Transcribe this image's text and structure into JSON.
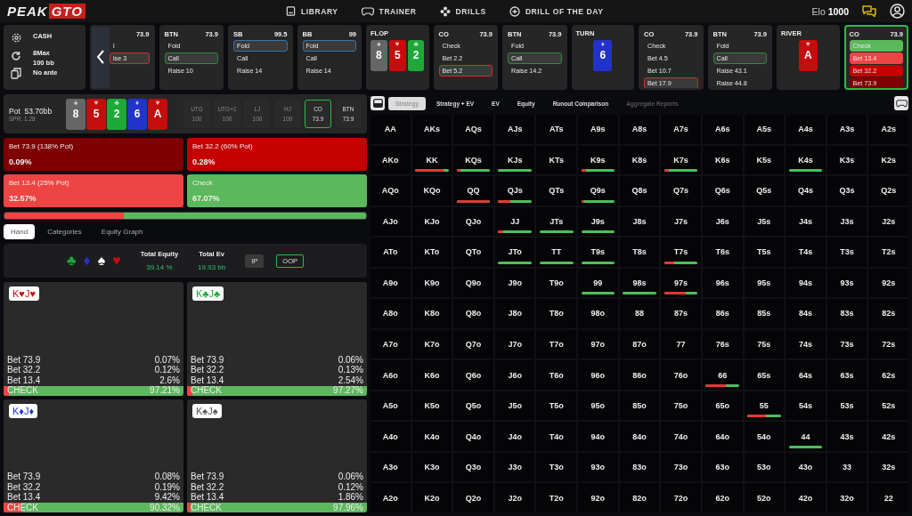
{
  "nav": {
    "logo": {
      "part_1": "PEAK",
      "part_2": "GTO"
    },
    "links": [
      "LIBRARY",
      "TRAINER",
      "DRILLS",
      "DRILL OF THE DAY"
    ],
    "elo": {
      "label": "Elo",
      "value": "1000"
    }
  },
  "settings_card": {
    "lines": [
      "CASH",
      "8Max",
      "100 bb",
      "No ante"
    ]
  },
  "action_strip": [
    {
      "kind": "action",
      "active": false,
      "covered": true,
      "stack": "73.9",
      "options": [
        {
          "label": "l",
          "selected": false
        },
        {
          "label": "ise 3",
          "selected": true,
          "color": "#d32f2f"
        }
      ]
    },
    {
      "kind": "action",
      "active": false,
      "covered": false,
      "position": "BTN",
      "stack": "73.9",
      "options": [
        {
          "label": "Fold",
          "selected": false
        },
        {
          "label": "Call",
          "selected": true,
          "color": "#2e8b3a"
        },
        {
          "label": "Raise 10",
          "selected": false
        }
      ]
    },
    {
      "kind": "action",
      "active": false,
      "covered": false,
      "position": "SB",
      "stack": "99.5",
      "options": [
        {
          "label": "Fold",
          "selected": true,
          "color": "#3d6fb0"
        },
        {
          "label": "Call",
          "selected": false
        },
        {
          "label": "Raise 14",
          "selected": false
        }
      ]
    },
    {
      "kind": "action",
      "active": false,
      "covered": false,
      "position": "BB",
      "stack": "99",
      "options": [
        {
          "label": "Fold",
          "selected": true,
          "color": "#3d6fb0"
        },
        {
          "label": "Call",
          "selected": false
        },
        {
          "label": "Raise 14",
          "selected": false
        }
      ]
    },
    {
      "kind": "street",
      "street": "FLOP",
      "cards": [
        {
          "rank": "8",
          "suit": "♠",
          "color": "#666666"
        },
        {
          "rank": "5",
          "suit": "♥",
          "color": "#c40d0d"
        },
        {
          "rank": "2",
          "suit": "♣",
          "color": "#1ea83a"
        }
      ]
    },
    {
      "kind": "action",
      "active": false,
      "covered": false,
      "position": "CO",
      "stack": "73.9",
      "options": [
        {
          "label": "Check",
          "selected": false
        },
        {
          "label": "Bet 2.2",
          "selected": false
        },
        {
          "label": "Bet 5.2",
          "selected": true,
          "color": "#d32f2f"
        }
      ]
    },
    {
      "kind": "action",
      "active": false,
      "covered": false,
      "position": "BTN",
      "stack": "73.9",
      "options": [
        {
          "label": "Fold",
          "selected": false
        },
        {
          "label": "Call",
          "selected": true,
          "color": "#2e8b3a"
        },
        {
          "label": "Raise 14.2",
          "selected": false
        }
      ]
    },
    {
      "kind": "street",
      "street": "TURN",
      "cards": [
        {
          "rank": "6",
          "suit": "♦",
          "color": "#2233cc"
        }
      ]
    },
    {
      "kind": "action",
      "active": false,
      "covered": false,
      "position": "CO",
      "stack": "73.9",
      "options": [
        {
          "label": "Check",
          "selected": false
        },
        {
          "label": "Bet 4.5",
          "selected": false
        },
        {
          "label": "Bet 10.7",
          "selected": false
        },
        {
          "label": "Bet 17.9",
          "selected": true,
          "color": "#d32f2f"
        }
      ]
    },
    {
      "kind": "action",
      "active": false,
      "covered": false,
      "position": "BTN",
      "stack": "73.9",
      "options": [
        {
          "label": "Fold",
          "selected": false
        },
        {
          "label": "Call",
          "selected": true,
          "color": "#2e8b3a"
        },
        {
          "label": "Raise 43.1",
          "selected": false
        },
        {
          "label": "Raise 44.8",
          "selected": false
        }
      ]
    },
    {
      "kind": "street",
      "street": "RIVER",
      "cards": [
        {
          "rank": "A",
          "suit": "♥",
          "color": "#c40d0d"
        }
      ]
    },
    {
      "kind": "action",
      "active": true,
      "covered": false,
      "position": "CO",
      "stack": "73.9",
      "options": [
        {
          "label": "Check",
          "selected": false,
          "color": "#5cb85c"
        },
        {
          "label": "Bet 13.4",
          "selected": false,
          "color": "#ef4444"
        },
        {
          "label": "Bet 32.2",
          "selected": false,
          "color": "#c40000"
        },
        {
          "label": "Bet 73.9",
          "selected": false,
          "color": "#7e0000"
        }
      ]
    }
  ],
  "board": {
    "pot_label": "Pot",
    "pot": "53.70bb",
    "spr": "SPR: 1.28",
    "cards": [
      {
        "rank": "8",
        "suit": "♠",
        "color": "#666666"
      },
      {
        "rank": "5",
        "suit": "♥",
        "color": "#c40d0d"
      },
      {
        "rank": "2",
        "suit": "♣",
        "color": "#1ea83a"
      },
      {
        "rank": "6",
        "suit": "♦",
        "color": "#2233cc"
      },
      {
        "rank": "A",
        "suit": "♥",
        "color": "#c40d0d"
      }
    ],
    "seats": [
      {
        "position": "UTG",
        "stack": "100",
        "disabled": true,
        "selected": false
      },
      {
        "position": "UTG+1",
        "stack": "100",
        "disabled": true,
        "selected": false
      },
      {
        "position": "LJ",
        "stack": "100",
        "disabled": true,
        "selected": false
      },
      {
        "position": "HJ",
        "stack": "100",
        "disabled": true,
        "selected": false
      },
      {
        "position": "CO",
        "stack": "73.9",
        "disabled": false,
        "selected": true
      },
      {
        "position": "BTN",
        "stack": "73.9",
        "disabled": false,
        "selected": false
      }
    ]
  },
  "actions": [
    {
      "label": "Bet 73.9 (138% Pot)",
      "frequency": "0.09%",
      "color": "#7e0000"
    },
    {
      "label": "Bet 32.2 (60% Pot)",
      "frequency": "0.28%",
      "color": "#c40000"
    },
    {
      "label": "Bet 13.4 (25% Pot)",
      "frequency": "32.57%",
      "color": "#ef4444"
    },
    {
      "label": "Check",
      "frequency": "67.07%",
      "color": "#5cb85c"
    }
  ],
  "strategy_bar": [
    {
      "level": 0.33,
      "color": "#ef4444"
    },
    {
      "level": 0.67,
      "color": "#5cb85c"
    }
  ],
  "left_tabs": [
    {
      "label": "Hand",
      "selected": true
    },
    {
      "label": "Categories",
      "selected": false
    },
    {
      "label": "Equity Graph",
      "selected": false
    }
  ],
  "summary": {
    "suits": [
      {
        "suit": "♣",
        "color": "#1ea83a"
      },
      {
        "suit": "♦",
        "color": "#2233cc"
      },
      {
        "suit": "♠",
        "color": "#ffffff"
      },
      {
        "suit": "♥",
        "color": "#c40d0d"
      }
    ],
    "stats": [
      {
        "label": "Total Equity",
        "value": "39.14 %"
      },
      {
        "label": "Total Ev",
        "value": "19.93 bb"
      }
    ],
    "players": [
      {
        "label": "IP",
        "selected": false
      },
      {
        "label": "OOP",
        "selected": true
      }
    ]
  },
  "combos": [
    {
      "cards": [
        {
          "rank": "K",
          "suit": "♥"
        },
        {
          "rank": "J",
          "suit": "♥"
        }
      ],
      "color": "#c40d0d",
      "rows": [
        {
          "action": "Bet 73.9",
          "value": "0.07%"
        },
        {
          "action": "Bet 32.2",
          "value": "0.12%"
        },
        {
          "action": "Bet 13.4",
          "value": "2.6%"
        },
        {
          "action": "CHECK",
          "value": "97.21%"
        }
      ],
      "bar": {
        "level": 0.03
      }
    },
    {
      "cards": [
        {
          "rank": "K",
          "suit": "♣"
        },
        {
          "rank": "J",
          "suit": "♣"
        }
      ],
      "color": "#1ea83a",
      "rows": [
        {
          "action": "Bet 73.9",
          "value": "0.06%"
        },
        {
          "action": "Bet 32.2",
          "value": "0.13%"
        },
        {
          "action": "Bet 13.4",
          "value": "2.54%"
        },
        {
          "action": "CHECK",
          "value": "97.27%"
        }
      ],
      "bar": {
        "level": 0.03
      }
    },
    {
      "cards": [
        {
          "rank": "K",
          "suit": "♦"
        },
        {
          "rank": "J",
          "suit": "♦"
        }
      ],
      "color": "#2233cc",
      "rows": [
        {
          "action": "Bet 73.9",
          "value": "0.08%"
        },
        {
          "action": "Bet 32.2",
          "value": "0.19%"
        },
        {
          "action": "Bet 13.4",
          "value": "9.42%"
        },
        {
          "action": "CHECK",
          "value": "90.32%"
        }
      ],
      "bar": {
        "level": 0.097
      }
    },
    {
      "cards": [
        {
          "rank": "K",
          "suit": "♠"
        },
        {
          "rank": "J",
          "suit": "♠"
        }
      ],
      "color": "#555555",
      "rows": [
        {
          "action": "Bet 73.9",
          "value": "0.06%"
        },
        {
          "action": "Bet 32.2",
          "value": "0.12%"
        },
        {
          "action": "Bet 13.4",
          "value": "1.86%"
        },
        {
          "action": "CHECK",
          "value": "97.96%"
        }
      ],
      "bar": {
        "level": 0.02
      }
    }
  ],
  "right_tabs": [
    {
      "label": "Strategy",
      "selected": true,
      "disabled": false
    },
    {
      "label": "Strategy + EV",
      "selected": false,
      "disabled": false
    },
    {
      "label": "EV",
      "selected": false,
      "disabled": false
    },
    {
      "label": "Equity",
      "selected": false,
      "disabled": false
    },
    {
      "label": "Runout Comparison",
      "selected": false,
      "disabled": false
    },
    {
      "label": "Aggregate Reports",
      "selected": false,
      "disabled": true
    }
  ],
  "matrix": [
    [
      {
        "label": "AA"
      },
      {
        "label": "AKs"
      },
      {
        "label": "AQs"
      },
      {
        "label": "AJs"
      },
      {
        "label": "ATs"
      },
      {
        "label": "A9s"
      },
      {
        "label": "A8s"
      },
      {
        "label": "A7s"
      },
      {
        "label": "A6s"
      },
      {
        "label": "A5s"
      },
      {
        "label": "A4s"
      },
      {
        "label": "A3s"
      },
      {
        "label": "A2s"
      }
    ],
    [
      {
        "label": "AKo"
      },
      {
        "label": "KK",
        "bar": {
          "level": 0.85
        }
      },
      {
        "label": "KQs",
        "bar": {
          "level": 0.1
        }
      },
      {
        "label": "KJs",
        "bar": {
          "level": 0
        }
      },
      {
        "label": "KTs"
      },
      {
        "label": "K9s",
        "bar": {
          "level": 0.15
        }
      },
      {
        "label": "K8s"
      },
      {
        "label": "K7s",
        "bar": {
          "level": 0.15
        }
      },
      {
        "label": "K6s"
      },
      {
        "label": "K5s"
      },
      {
        "label": "K4s",
        "bar": {
          "level": 0
        }
      },
      {
        "label": "K3s"
      },
      {
        "label": "K2s"
      }
    ],
    [
      {
        "label": "AQo"
      },
      {
        "label": "KQo"
      },
      {
        "label": "QQ",
        "bar": {
          "level": 0.97
        }
      },
      {
        "label": "QJs",
        "bar": {
          "level": 0.35
        }
      },
      {
        "label": "QTs"
      },
      {
        "label": "Q9s",
        "bar": {
          "level": 0.1
        }
      },
      {
        "label": "Q8s"
      },
      {
        "label": "Q7s"
      },
      {
        "label": "Q6s"
      },
      {
        "label": "Q5s"
      },
      {
        "label": "Q4s"
      },
      {
        "label": "Q3s"
      },
      {
        "label": "Q2s"
      }
    ],
    [
      {
        "label": "AJo"
      },
      {
        "label": "KJo"
      },
      {
        "label": "QJo"
      },
      {
        "label": "JJ",
        "bar": {
          "level": 0.15
        }
      },
      {
        "label": "JTs",
        "bar": {
          "level": 0
        }
      },
      {
        "label": "J9s",
        "bar": {
          "level": 0
        }
      },
      {
        "label": "J8s"
      },
      {
        "label": "J7s"
      },
      {
        "label": "J6s"
      },
      {
        "label": "J5s"
      },
      {
        "label": "J4s"
      },
      {
        "label": "J3s"
      },
      {
        "label": "J2s"
      }
    ],
    [
      {
        "label": "ATo"
      },
      {
        "label": "KTo"
      },
      {
        "label": "QTo"
      },
      {
        "label": "JTo",
        "bar": {
          "level": 0
        }
      },
      {
        "label": "TT",
        "bar": {
          "level": 0
        }
      },
      {
        "label": "T9s",
        "bar": {
          "level": 0
        }
      },
      {
        "label": "T8s"
      },
      {
        "label": "T7s",
        "bar": {
          "level": 0.3
        }
      },
      {
        "label": "T6s"
      },
      {
        "label": "T5s"
      },
      {
        "label": "T4s"
      },
      {
        "label": "T3s"
      },
      {
        "label": "T2s"
      }
    ],
    [
      {
        "label": "A9o"
      },
      {
        "label": "K9o"
      },
      {
        "label": "Q9o"
      },
      {
        "label": "J9o"
      },
      {
        "label": "T9o"
      },
      {
        "label": "99",
        "bar": {
          "level": 0
        }
      },
      {
        "label": "98s",
        "bar": {
          "level": 0
        }
      },
      {
        "label": "97s",
        "bar": {
          "level": 0.65
        }
      },
      {
        "label": "96s"
      },
      {
        "label": "95s"
      },
      {
        "label": "94s"
      },
      {
        "label": "93s"
      },
      {
        "label": "92s"
      }
    ],
    [
      {
        "label": "A8o"
      },
      {
        "label": "K8o"
      },
      {
        "label": "Q8o"
      },
      {
        "label": "J8o"
      },
      {
        "label": "T8o"
      },
      {
        "label": "98o"
      },
      {
        "label": "88"
      },
      {
        "label": "87s"
      },
      {
        "label": "86s"
      },
      {
        "label": "85s"
      },
      {
        "label": "84s"
      },
      {
        "label": "83s"
      },
      {
        "label": "82s"
      }
    ],
    [
      {
        "label": "A7o"
      },
      {
        "label": "K7o"
      },
      {
        "label": "Q7o"
      },
      {
        "label": "J7o"
      },
      {
        "label": "T7o"
      },
      {
        "label": "97o"
      },
      {
        "label": "87o"
      },
      {
        "label": "77"
      },
      {
        "label": "76s"
      },
      {
        "label": "75s"
      },
      {
        "label": "74s"
      },
      {
        "label": "73s"
      },
      {
        "label": "72s"
      }
    ],
    [
      {
        "label": "A6o"
      },
      {
        "label": "K6o"
      },
      {
        "label": "Q6o"
      },
      {
        "label": "J6o"
      },
      {
        "label": "T6o"
      },
      {
        "label": "96o"
      },
      {
        "label": "86o"
      },
      {
        "label": "76o"
      },
      {
        "label": "66",
        "bar": {
          "level": 0.6
        }
      },
      {
        "label": "65s"
      },
      {
        "label": "64s"
      },
      {
        "label": "63s"
      },
      {
        "label": "62s"
      }
    ],
    [
      {
        "label": "A5o"
      },
      {
        "label": "K5o"
      },
      {
        "label": "Q5o"
      },
      {
        "label": "J5o"
      },
      {
        "label": "T5o"
      },
      {
        "label": "95o"
      },
      {
        "label": "85o"
      },
      {
        "label": "75o"
      },
      {
        "label": "65o"
      },
      {
        "label": "55",
        "bar": {
          "level": 0.55
        }
      },
      {
        "label": "54s"
      },
      {
        "label": "53s"
      },
      {
        "label": "52s"
      }
    ],
    [
      {
        "label": "A4o"
      },
      {
        "label": "K4o"
      },
      {
        "label": "Q4o"
      },
      {
        "label": "J4o"
      },
      {
        "label": "T4o"
      },
      {
        "label": "94o"
      },
      {
        "label": "84o"
      },
      {
        "label": "74o"
      },
      {
        "label": "64o"
      },
      {
        "label": "54o"
      },
      {
        "label": "44",
        "bar": {
          "level": 0
        }
      },
      {
        "label": "43s"
      },
      {
        "label": "42s"
      }
    ],
    [
      {
        "label": "A3o"
      },
      {
        "label": "K3o"
      },
      {
        "label": "Q3o"
      },
      {
        "label": "J3o"
      },
      {
        "label": "T3o"
      },
      {
        "label": "93o"
      },
      {
        "label": "83o"
      },
      {
        "label": "73o"
      },
      {
        "label": "63o"
      },
      {
        "label": "53o"
      },
      {
        "label": "43o"
      },
      {
        "label": "33"
      },
      {
        "label": "32s"
      }
    ],
    [
      {
        "label": "A2o"
      },
      {
        "label": "K2o"
      },
      {
        "label": "Q2o"
      },
      {
        "label": "J2o"
      },
      {
        "label": "T2o"
      },
      {
        "label": "92o"
      },
      {
        "label": "82o"
      },
      {
        "label": "72o"
      },
      {
        "label": "62o"
      },
      {
        "label": "52o"
      },
      {
        "label": "42o"
      },
      {
        "label": "32o"
      },
      {
        "label": "22"
      }
    ]
  ]
}
